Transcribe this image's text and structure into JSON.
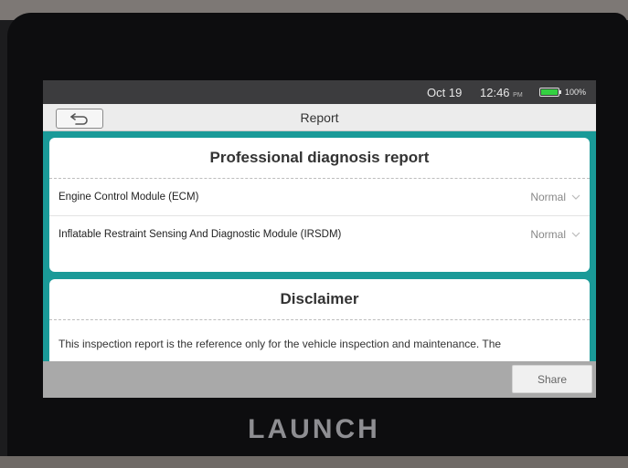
{
  "status_bar": {
    "date": "Oct 19",
    "time": "12:46",
    "ampm": "PM",
    "battery_percent": "100%",
    "battery_level": 1.0,
    "battery_color": "#34d041"
  },
  "header": {
    "back_icon": "back-arrow-icon",
    "title": "Report"
  },
  "report_card": {
    "title": "Professional diagnosis report",
    "modules": [
      {
        "name": "Engine Control Module (ECM)",
        "status": "Normal",
        "icon": "chevron-down-icon"
      },
      {
        "name": "Inflatable Restraint Sensing And Diagnostic Module (IRSDM)",
        "status": "Normal",
        "icon": "chevron-down-icon"
      }
    ]
  },
  "disclaimer_card": {
    "title": "Disclaimer",
    "text": "This inspection report is the reference only for the vehicle inspection and maintenance. The"
  },
  "footer": {
    "share_label": "Share"
  },
  "device": {
    "brand": "LAUNCH"
  },
  "colors": {
    "accent": "#1a9a98",
    "titlebar": "#ececec",
    "statusbar": "#3c3c3e"
  }
}
